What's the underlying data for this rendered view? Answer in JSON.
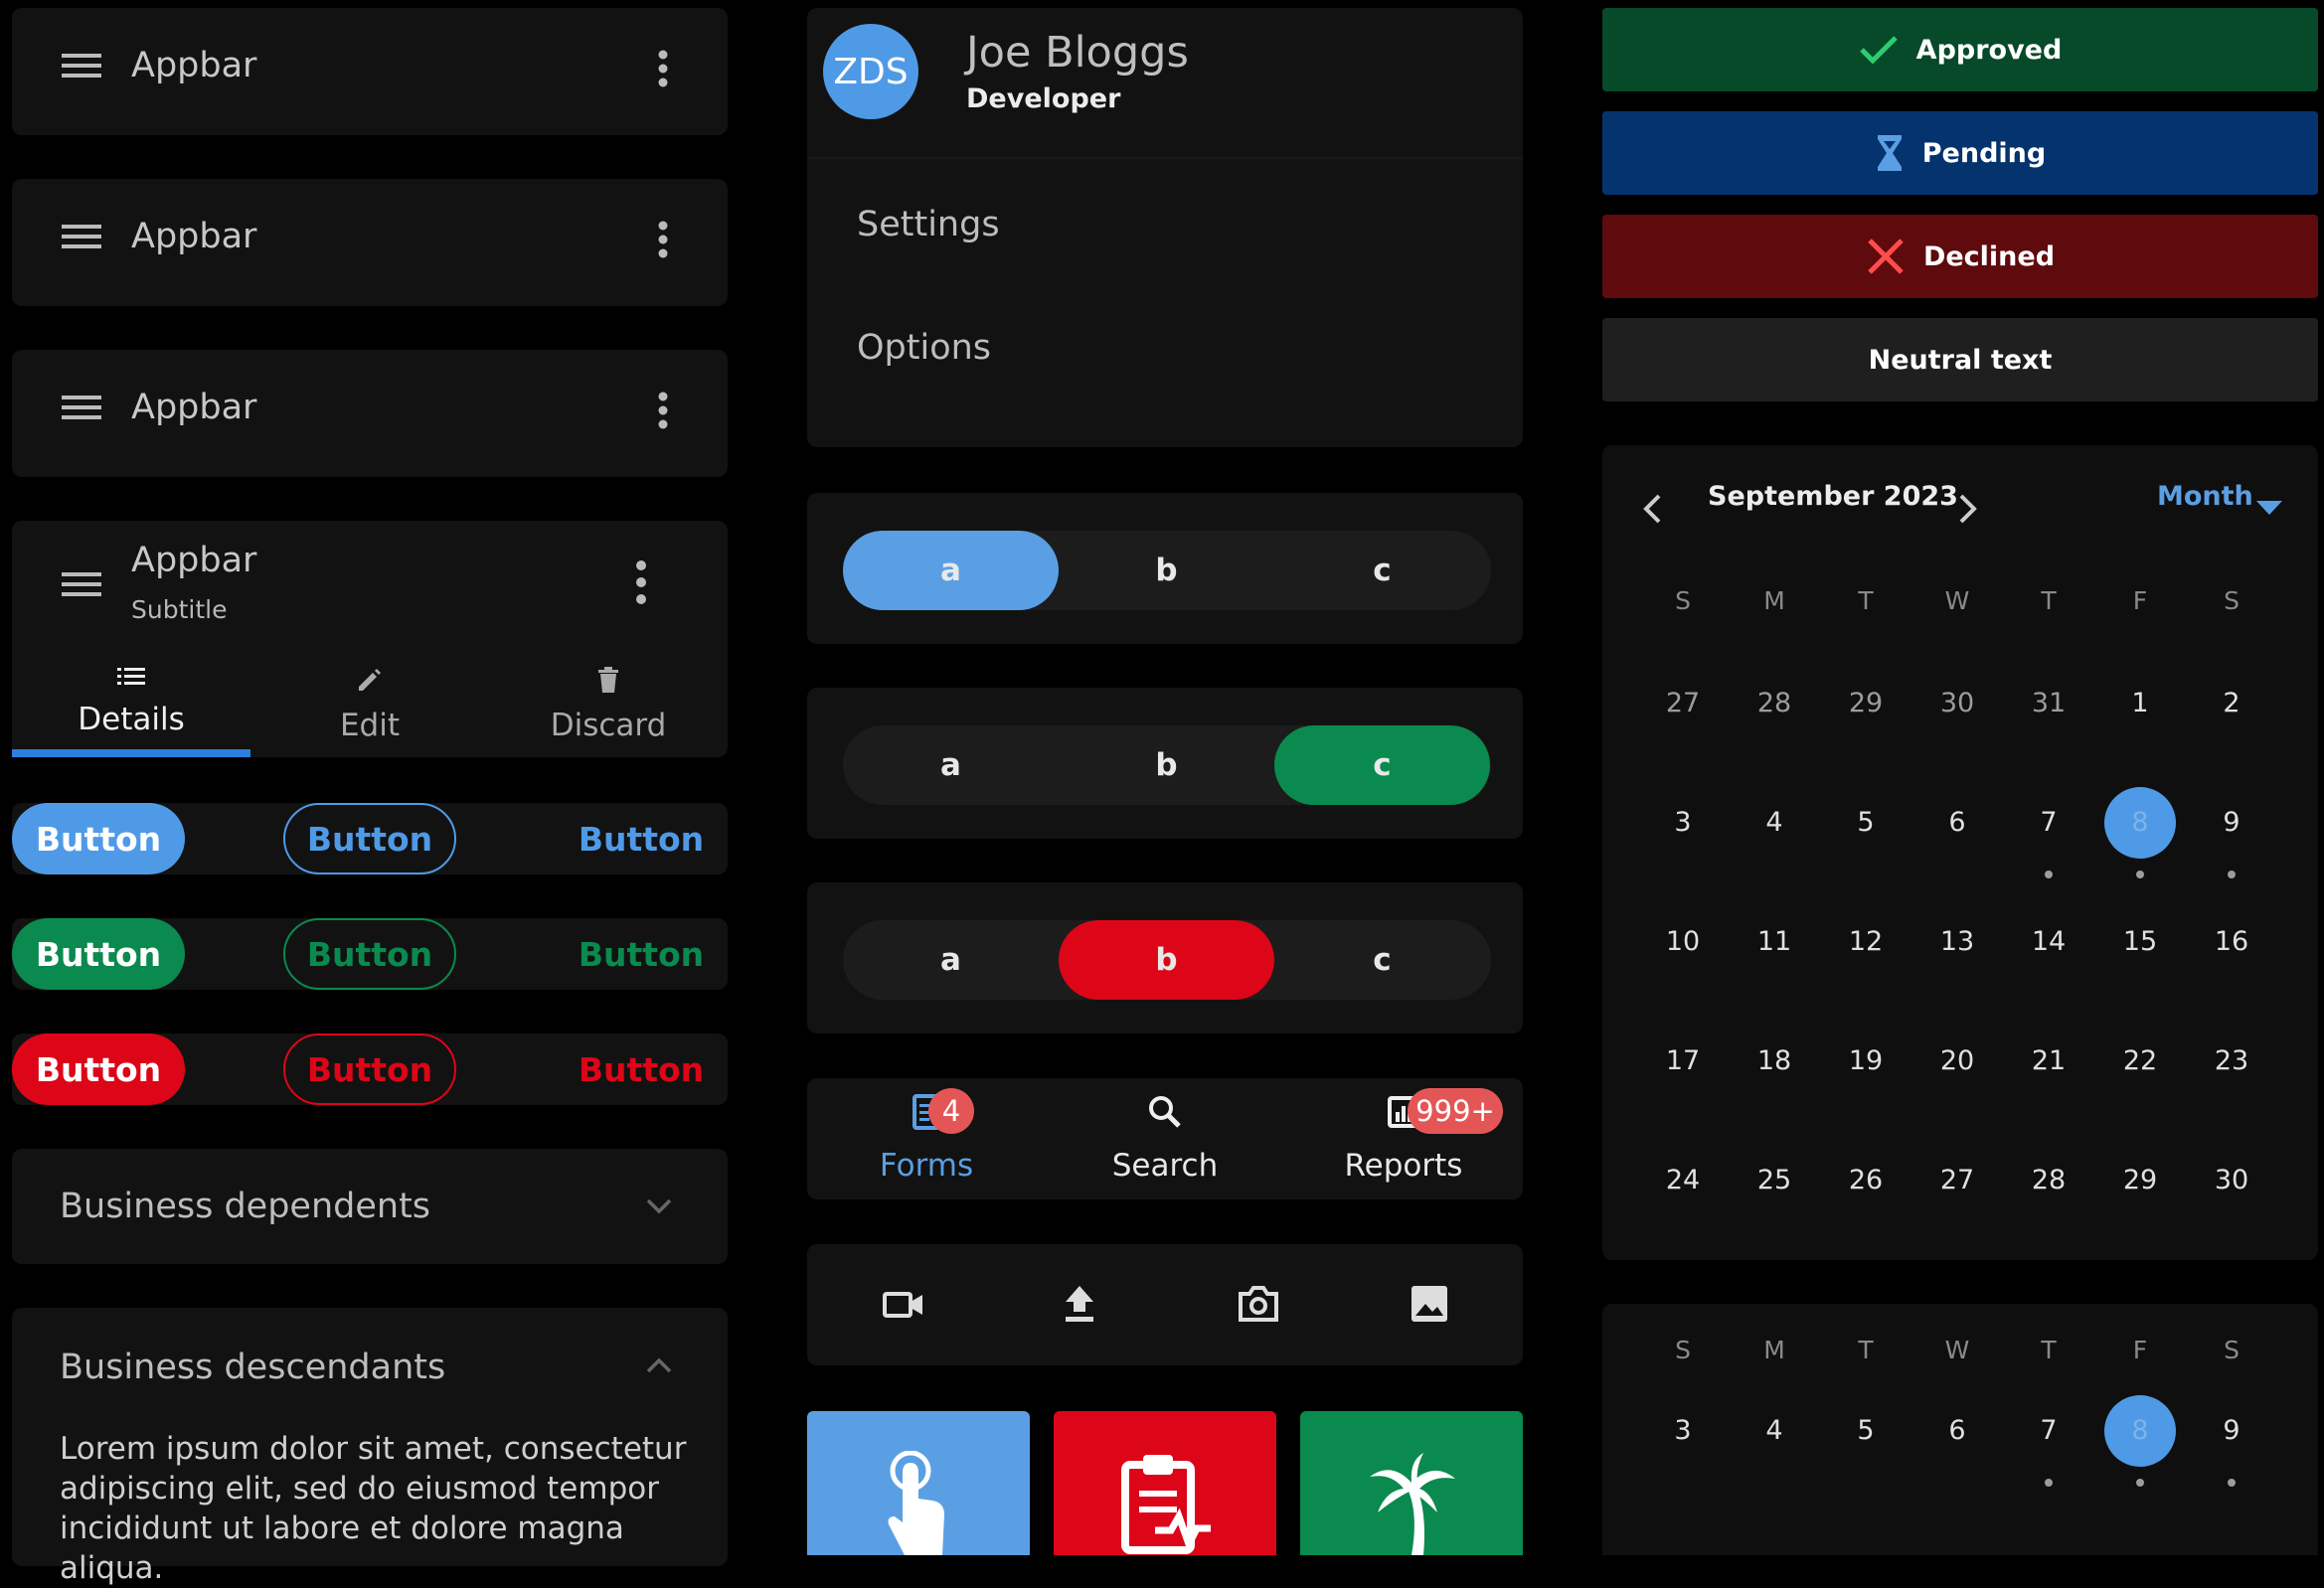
{
  "appbars": [
    {
      "title": "Appbar"
    },
    {
      "title": "Appbar"
    },
    {
      "title": "Appbar"
    }
  ],
  "appbar_tabs": {
    "title": "Appbar",
    "subtitle": "Subtitle",
    "tabs": [
      {
        "label": "Details",
        "icon": "list-icon",
        "active": true
      },
      {
        "label": "Edit",
        "icon": "pencil-icon",
        "active": false
      },
      {
        "label": "Discard",
        "icon": "trash-icon",
        "active": false
      }
    ]
  },
  "buttons": {
    "label": "Button",
    "rows": [
      {
        "color": "#4f9ae6"
      },
      {
        "color": "#0a8a4e"
      },
      {
        "color": "#dd0518"
      }
    ]
  },
  "expansion": [
    {
      "title": "Business dependents",
      "expanded": false
    },
    {
      "title": "Business descendants",
      "expanded": true,
      "body": "Lorem ipsum dolor sit amet, consectetur adipiscing elit, sed do eiusmod tempor incididunt ut labore et dolore magna aliqua."
    }
  ],
  "profile": {
    "initials": "ZDS",
    "name": "Joe Bloggs",
    "role": "Developer",
    "menu": [
      "Settings",
      "Options"
    ]
  },
  "segmented": [
    {
      "options": [
        "a",
        "b",
        "c"
      ],
      "selected": 0,
      "color": "#5a9fe4"
    },
    {
      "options": [
        "a",
        "b",
        "c"
      ],
      "selected": 2,
      "color": "#0a8a4e"
    },
    {
      "options": [
        "a",
        "b",
        "c"
      ],
      "selected": 1,
      "color": "#dd0518"
    }
  ],
  "bottom_nav": {
    "items": [
      {
        "label": "Forms",
        "icon": "forms-icon",
        "badge": "4",
        "active": true
      },
      {
        "label": "Search",
        "icon": "search-icon",
        "badge": "",
        "active": false
      },
      {
        "label": "Reports",
        "icon": "reports-icon",
        "badge": "999+",
        "active": false
      }
    ]
  },
  "media_icons": [
    "video-icon",
    "upload-icon",
    "camera-icon",
    "image-icon"
  ],
  "tiles": [
    {
      "icon": "touch-icon",
      "color": "#5a9fe4"
    },
    {
      "icon": "clipboard-pulse-icon",
      "color": "#dd0518"
    },
    {
      "icon": "palm-tree-icon",
      "color": "#0a8a4e"
    }
  ],
  "status_banners": [
    {
      "label": "Approved",
      "icon": "check-icon",
      "color": "#064a2a"
    },
    {
      "label": "Pending",
      "icon": "hourglass-icon",
      "color": "#05336d"
    },
    {
      "label": "Declined",
      "icon": "x-icon",
      "color": "#5f0a0d"
    },
    {
      "label": "Neutral text",
      "icon": "",
      "color": "#1f1f1f"
    }
  ],
  "calendar": {
    "month_label": "September 2023",
    "view_label": "Month",
    "weekdays": [
      "S",
      "M",
      "T",
      "W",
      "T",
      "F",
      "S"
    ],
    "weeks": [
      [
        "27",
        "28",
        "29",
        "30",
        "31",
        "1",
        "2"
      ],
      [
        "3",
        "4",
        "5",
        "6",
        "7",
        "8",
        "9"
      ],
      [
        "10",
        "11",
        "12",
        "13",
        "14",
        "15",
        "16"
      ],
      [
        "17",
        "18",
        "19",
        "20",
        "21",
        "22",
        "23"
      ],
      [
        "24",
        "25",
        "26",
        "27",
        "28",
        "29",
        "30"
      ]
    ],
    "selected_day": "8",
    "event_days": [
      "7",
      "8",
      "9"
    ]
  },
  "week_strip": {
    "weekdays": [
      "S",
      "M",
      "T",
      "W",
      "T",
      "F",
      "S"
    ],
    "days": [
      "3",
      "4",
      "5",
      "6",
      "7",
      "8",
      "9"
    ],
    "selected_day": "8",
    "event_days": [
      "7",
      "8",
      "9"
    ]
  }
}
